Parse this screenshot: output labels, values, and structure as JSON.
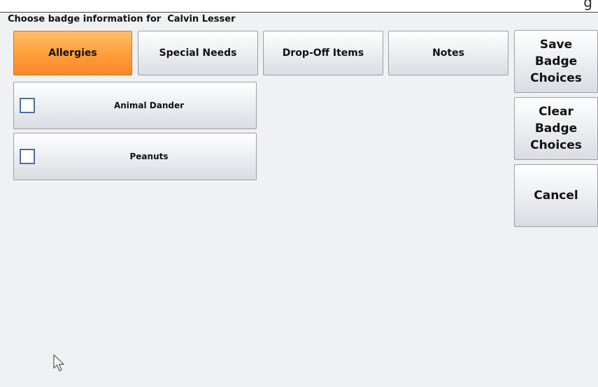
{
  "header": {
    "title": "Choose badge information for  Calvin Lesser"
  },
  "tabs": [
    {
      "label": "Allergies",
      "active": true
    },
    {
      "label": "Special Needs",
      "active": false
    },
    {
      "label": "Drop-Off Items",
      "active": false
    },
    {
      "label": "Notes",
      "active": false
    }
  ],
  "items": [
    {
      "label": "Animal Dander",
      "checked": false
    },
    {
      "label": "Peanuts",
      "checked": false
    }
  ],
  "actions": {
    "save_lines": [
      "Save",
      "Badge",
      "Choices"
    ],
    "clear_lines": [
      "Clear",
      "Badge",
      "Choices"
    ],
    "cancel_label": "Cancel"
  },
  "colors": {
    "active_tab": "#ff9c3a",
    "background": "#f0f1f3",
    "checkbox_border": "#4b6f9e"
  },
  "icons": {
    "cursor": "arrow-cursor-icon"
  }
}
